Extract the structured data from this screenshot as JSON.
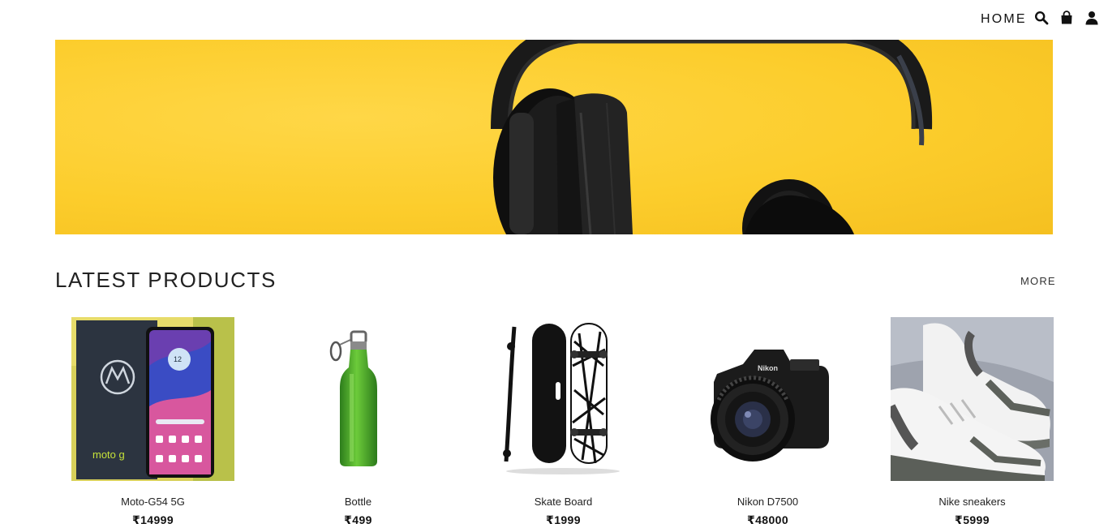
{
  "nav": {
    "home_label": "HOME",
    "icons": [
      "search-icon",
      "shopping-bag-icon",
      "user-icon"
    ]
  },
  "banner": {
    "subject": "headphones-on-yellow",
    "background_color": "#fccd2c"
  },
  "section": {
    "title": "LATEST PRODUCTS",
    "more_label": "MORE"
  },
  "products": [
    {
      "name": "Moto-G54 5G",
      "price": "₹14999"
    },
    {
      "name": "Bottle",
      "price": "₹499"
    },
    {
      "name": "Skate Board",
      "price": "₹1999"
    },
    {
      "name": "Nikon D7500",
      "price": "₹48000"
    },
    {
      "name": "Nike sneakers",
      "price": "₹5999"
    }
  ],
  "colors": {
    "text": "#111111",
    "banner_yellow": "#fccd2c",
    "bottle_green": "#3fa12a"
  }
}
